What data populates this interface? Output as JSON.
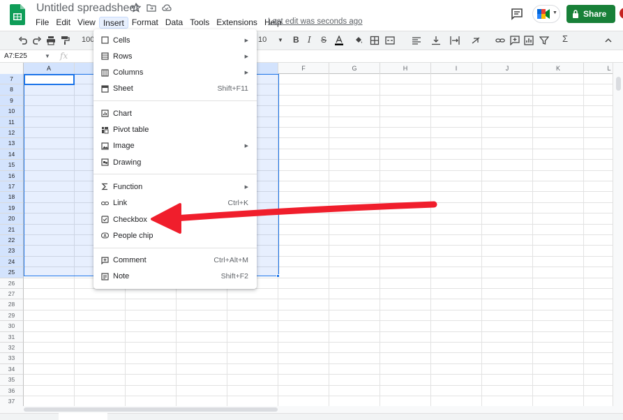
{
  "app": {
    "title": "Untitled spreadsheet",
    "last_edit": "Last edit was seconds ago",
    "share_label": "Share"
  },
  "menubar": [
    "File",
    "Edit",
    "View",
    "Insert",
    "Format",
    "Data",
    "Tools",
    "Extensions",
    "Help"
  ],
  "toolbar": {
    "zoom": "100",
    "font_size": "10"
  },
  "formula_bar": {
    "name_box": "A7:E25",
    "fx": "fx"
  },
  "columns": [
    "A",
    "B",
    "C",
    "D",
    "E",
    "F",
    "G",
    "H",
    "I",
    "J",
    "K",
    "L"
  ],
  "rows": [
    "7",
    "8",
    "9",
    "10",
    "11",
    "12",
    "13",
    "14",
    "15",
    "16",
    "17",
    "18",
    "19",
    "20",
    "21",
    "22",
    "23",
    "24",
    "25",
    "26",
    "27",
    "28",
    "29",
    "30",
    "31",
    "32",
    "33",
    "34",
    "35",
    "36",
    "37"
  ],
  "insert_menu": {
    "groups": [
      [
        {
          "label": "Cells",
          "icon": "cells-icon",
          "submenu": true
        },
        {
          "label": "Rows",
          "icon": "rows-icon",
          "submenu": true
        },
        {
          "label": "Columns",
          "icon": "columns-icon",
          "submenu": true
        },
        {
          "label": "Sheet",
          "icon": "sheet-icon",
          "shortcut": "Shift+F11"
        }
      ],
      [
        {
          "label": "Chart",
          "icon": "chart-icon"
        },
        {
          "label": "Pivot table",
          "icon": "pivot-table-icon"
        },
        {
          "label": "Image",
          "icon": "image-icon",
          "submenu": true
        },
        {
          "label": "Drawing",
          "icon": "drawing-icon"
        }
      ],
      [
        {
          "label": "Function",
          "icon": "sigma-icon",
          "submenu": true
        },
        {
          "label": "Link",
          "icon": "link-icon",
          "shortcut": "Ctrl+K"
        },
        {
          "label": "Checkbox",
          "icon": "checkbox-icon"
        },
        {
          "label": "People chip",
          "icon": "people-chip-icon"
        }
      ],
      [
        {
          "label": "Comment",
          "icon": "comment-icon",
          "shortcut": "Ctrl+Alt+M"
        },
        {
          "label": "Note",
          "icon": "note-icon",
          "shortcut": "Shift+F2"
        }
      ]
    ]
  },
  "colors": {
    "accent": "#1a73e8",
    "share_green": "#188038",
    "annotation_arrow": "#f01e2c"
  }
}
